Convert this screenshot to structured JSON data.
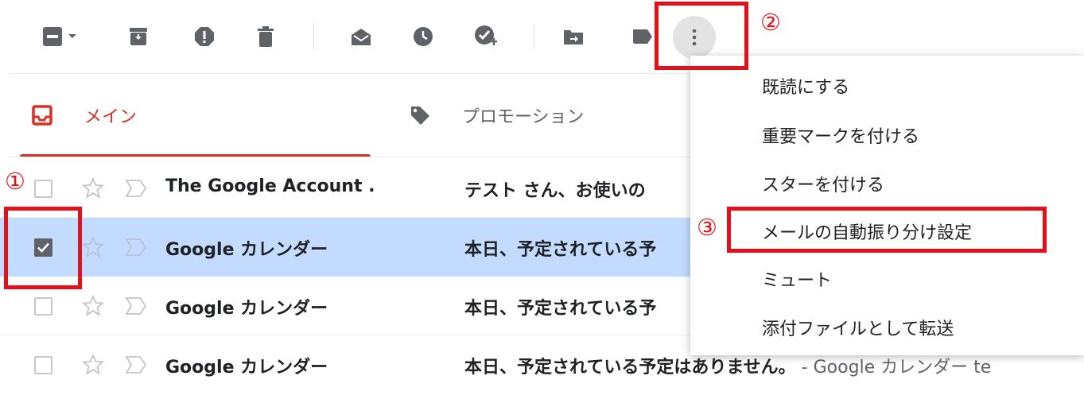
{
  "toolbar": {
    "icons": [
      "select-checkbox-icon",
      "dropdown-caret-icon",
      "archive-icon",
      "report-spam-icon",
      "delete-icon",
      "mark-read-icon",
      "snooze-icon",
      "add-to-tasks-icon",
      "move-to-icon",
      "label-icon",
      "more-vertical-icon"
    ]
  },
  "tabs": [
    {
      "label": "メイン",
      "icon": "inbox-icon",
      "active": true
    },
    {
      "label": "プロモーション",
      "icon": "tag-icon",
      "active": false
    }
  ],
  "emails": [
    {
      "sender": "The Google Account .",
      "subject": "テスト さん、お使いの",
      "snippet": "",
      "checked": false
    },
    {
      "sender": "Google カレンダー",
      "subject": "本日、予定されている予",
      "snippet": "",
      "checked": true
    },
    {
      "sender": "Google カレンダー",
      "subject": "本日、予定されている予",
      "snippet": "",
      "checked": false
    },
    {
      "sender": "Google カレンダー",
      "subject": "本日、予定されている予定はありません。",
      "snippet": " - Google カレンダー te",
      "checked": false
    }
  ],
  "menu": {
    "items": [
      "既読にする",
      "重要マークを付ける",
      "スターを付ける",
      "メールの自動振り分け設定",
      "ミュート",
      "添付ファイルとして転送"
    ]
  },
  "annotations": {
    "one": "①",
    "two": "②",
    "three": "③"
  },
  "colors": {
    "accent_red": "#d93025",
    "highlight_red": "#e3111b",
    "selected_row": "#c2dbff",
    "icon_gray": "#5f6368"
  }
}
